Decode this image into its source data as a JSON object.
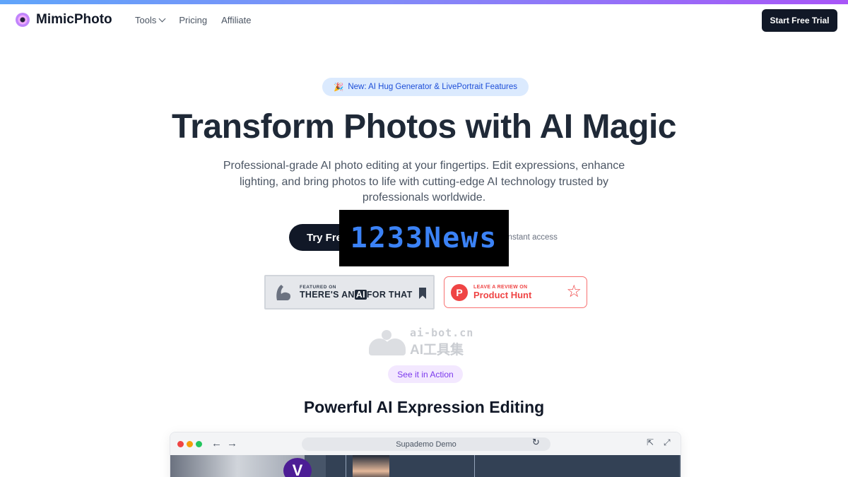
{
  "brand": {
    "name": "MimicPhoto"
  },
  "nav": {
    "links": [
      {
        "label": "Tools",
        "has_dropdown": true
      },
      {
        "label": "Pricing"
      },
      {
        "label": "Affiliate"
      }
    ],
    "cta": "Start Free Trial"
  },
  "hero": {
    "badge_emoji": "🎉",
    "badge": "New: AI Hug Generator & LivePortrait Features",
    "title": "Transform Photos with AI Magic",
    "subtitle": "Professional-grade AI photo editing at your fingertips. Edit expressions, enhance lighting, and bring photos to life with cutting-edge AI technology trusted by professionals worldwide.",
    "cta_visible": "Try Fre",
    "cta_note_visible": "instant access"
  },
  "overlay": {
    "text": "1233News"
  },
  "featured": {
    "aithat_small": "FEATURED ON",
    "aithat_big_pre": "THERE'S AN",
    "aithat_big_ai": "AI",
    "aithat_big_post": "FOR THAT",
    "ph_small": "LEAVE A REVIEW ON",
    "ph_big": "Product Hunt",
    "ph_letter": "P"
  },
  "watermark": {
    "line1": "ai-bot.cn",
    "line2": "AI工具集"
  },
  "section": {
    "pill": "See it in Action",
    "title": "Powerful AI Expression Editing"
  },
  "demo": {
    "url": "Supademo Demo",
    "preview_letter": "V"
  },
  "colors": {
    "accent": "#111827",
    "badge_bg": "#dbeafe",
    "pill_bg": "#f3e8ff",
    "product_hunt": "#ef4444"
  }
}
